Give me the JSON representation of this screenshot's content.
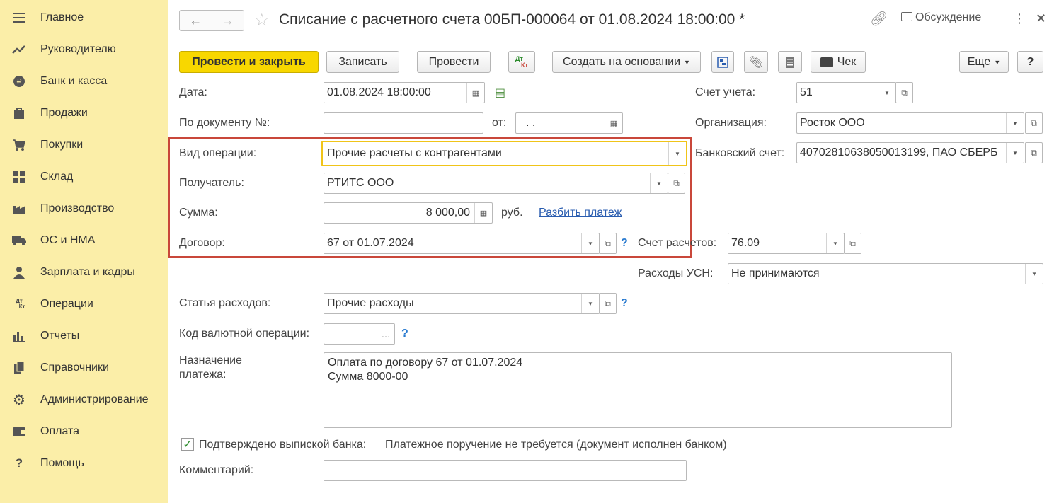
{
  "sidebar": {
    "items": [
      {
        "label": "Главное",
        "icon": "menu-icon"
      },
      {
        "label": "Руководителю",
        "icon": "chart-line-icon"
      },
      {
        "label": "Банк и касса",
        "icon": "ruble-coin-icon"
      },
      {
        "label": "Продажи",
        "icon": "shopping-bag-icon"
      },
      {
        "label": "Покупки",
        "icon": "cart-icon"
      },
      {
        "label": "Склад",
        "icon": "warehouse-icon"
      },
      {
        "label": "Производство",
        "icon": "factory-icon"
      },
      {
        "label": "ОС и НМА",
        "icon": "truck-icon"
      },
      {
        "label": "Зарплата и кадры",
        "icon": "person-icon"
      },
      {
        "label": "Операции",
        "icon": "dt-kt-icon"
      },
      {
        "label": "Отчеты",
        "icon": "bar-chart-icon"
      },
      {
        "label": "Справочники",
        "icon": "books-icon"
      },
      {
        "label": "Администрирование",
        "icon": "gear-icon"
      },
      {
        "label": "Оплата",
        "icon": "wallet-icon"
      },
      {
        "label": "Помощь",
        "icon": "question-icon"
      }
    ]
  },
  "header": {
    "title": "Списание с расчетного счета 00БП-000064 от 01.08.2024 18:00:00 *",
    "discussion": "Обсуждение"
  },
  "toolbar": {
    "post_close": "Провести и закрыть",
    "save": "Записать",
    "post": "Провести",
    "dtkt": "Дт Кт",
    "create_based": "Создать на основании",
    "receipt": "Чек",
    "more": "Еще",
    "help": "?"
  },
  "form": {
    "date_label": "Дата:",
    "date_value": "01.08.2024 18:00:00",
    "docnum_label": "По документу №:",
    "docnum_value": "",
    "from_label": "от:",
    "from_value": " .  .",
    "account_label": "Счет учета:",
    "account_value": "51",
    "org_label": "Организация:",
    "org_value": "Росток ООО",
    "bank_label": "Банковский счет:",
    "bank_value": "40702810638050013199, ПАО СБЕРБ",
    "op_label": "Вид операции:",
    "op_value": "Прочие расчеты с контрагентами",
    "recipient_label": "Получатель:",
    "recipient_value": "РТИТС ООО",
    "sum_label": "Сумма:",
    "sum_value": "8 000,00",
    "currency": "руб.",
    "split_link": "Разбить платеж",
    "contract_label": "Договор:",
    "contract_value": "67 от 01.07.2024",
    "settle_label": "Счет расчетов:",
    "settle_value": "76.09",
    "usn_label": "Расходы УСН:",
    "usn_value": "Не принимаются",
    "expense_label": "Статья расходов:",
    "expense_value": "Прочие расходы",
    "currency_op_label": "Код валютной операции:",
    "currency_op_value": "",
    "purpose_label": "Назначение платежа:",
    "purpose_value": "Оплата по договору 67 от 01.07.2024\nСумма 8000-00",
    "confirmed_label": "Подтверждено выпиской банка:",
    "confirmed_note": "Платежное поручение не требуется (документ исполнен банком)",
    "comment_label": "Комментарий:",
    "comment_value": ""
  }
}
